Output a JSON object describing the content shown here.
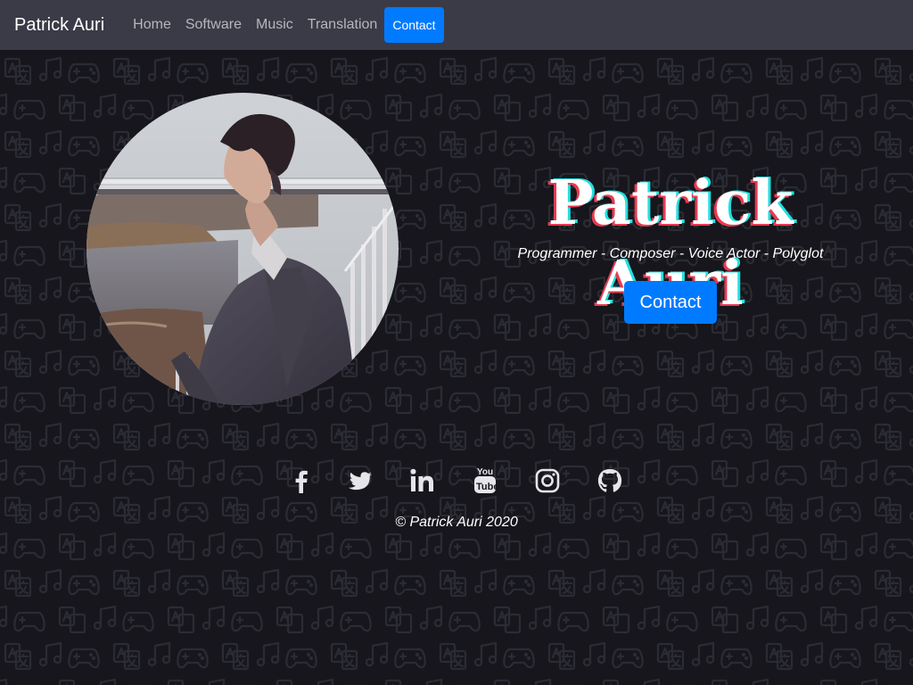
{
  "navbar": {
    "brand": "Patrick Auri",
    "links": [
      "Home",
      "Software",
      "Music",
      "Translation"
    ],
    "contact": "Contact"
  },
  "hero": {
    "name": "Patrick Auri",
    "tagline": "Programmer - Composer - Voice Actor - Polyglot",
    "contact_button": "Contact"
  },
  "social": {
    "icons": [
      "facebook-icon",
      "twitter-icon",
      "linkedin-icon",
      "youtube-icon",
      "instagram-icon",
      "github-icon"
    ]
  },
  "footer": {
    "copyright": "© Patrick Auri 2020"
  },
  "colors": {
    "background": "#16161c",
    "navbar": "#3b3b47",
    "accent": "#007bff",
    "name_shadow_red": "#e63b52",
    "name_shadow_cyan": "#21e0e0"
  }
}
